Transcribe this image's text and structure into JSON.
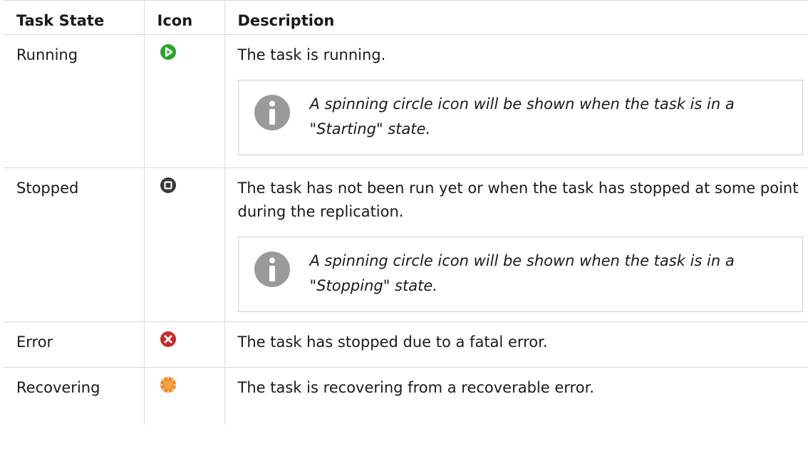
{
  "headers": {
    "state": "Task State",
    "icon": "Icon",
    "description": "Description"
  },
  "rows": [
    {
      "state": "Running",
      "icon": "running-play-icon",
      "icon_color": "#2aa52a",
      "description": "The task is running.",
      "note": "A spinning circle icon will be shown when the task is in a \"Starting\" state."
    },
    {
      "state": "Stopped",
      "icon": "stopped-square-icon",
      "icon_color": "#3a3a3a",
      "description": "The task has not been run yet or when the task has stopped at some point during the replication.",
      "note": "A spinning circle icon will be shown when the task is in a \"Stopping\" state."
    },
    {
      "state": "Error",
      "icon": "error-x-icon",
      "icon_color": "#c62a2a",
      "description": "The task has stopped due to a fatal error."
    },
    {
      "state": "Recovering",
      "icon": "recovering-sun-icon",
      "icon_color": "#f08a24",
      "description": "The task is recovering from a recoverable error."
    }
  ],
  "colors": {
    "border": "#d9d9d9",
    "info_icon": "#9a9a9a"
  }
}
